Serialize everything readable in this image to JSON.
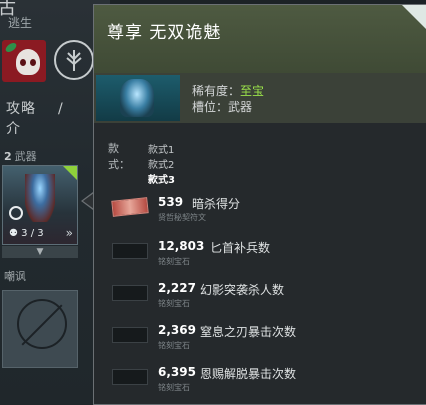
{
  "hero": {
    "name_partial": "古",
    "subtitle": "逃生"
  },
  "tabs": [
    "攻略",
    "/",
    "介"
  ],
  "slot": {
    "index": "2",
    "name": "武器",
    "count": "3 / 3",
    "expand": "▼"
  },
  "taunt_label": "嘲讽",
  "tooltip": {
    "title": "尊享 无双诡魅",
    "rarity_label": "稀有度：",
    "rarity_value": "至宝",
    "slot_label": "槽位：武器",
    "rarity_color": "#9be24a",
    "styles_label": "款式：",
    "styles": [
      "款式1",
      "款式2",
      "款式3"
    ],
    "active_style": "款式3",
    "trackers": [
      {
        "value": "539",
        "label": "暗杀得分",
        "sub": "贤哲秘契符文",
        "icon": "rune-gem-icon"
      },
      {
        "value": "12,803",
        "label": "匕首补兵数",
        "sub": "铭刻宝石",
        "icon": "gem-slot-icon"
      },
      {
        "value": "2,227",
        "label": "幻影突袭杀人数",
        "sub": "铭刻宝石",
        "icon": "gem-slot-icon"
      },
      {
        "value": "2,369",
        "label": "窒息之刃暴击次数",
        "sub": "铭刻宝石",
        "icon": "gem-slot-icon"
      },
      {
        "value": "6,395",
        "label": "恩赐解脱暴击次数",
        "sub": "铭刻宝石",
        "icon": "gem-slot-icon"
      }
    ]
  }
}
